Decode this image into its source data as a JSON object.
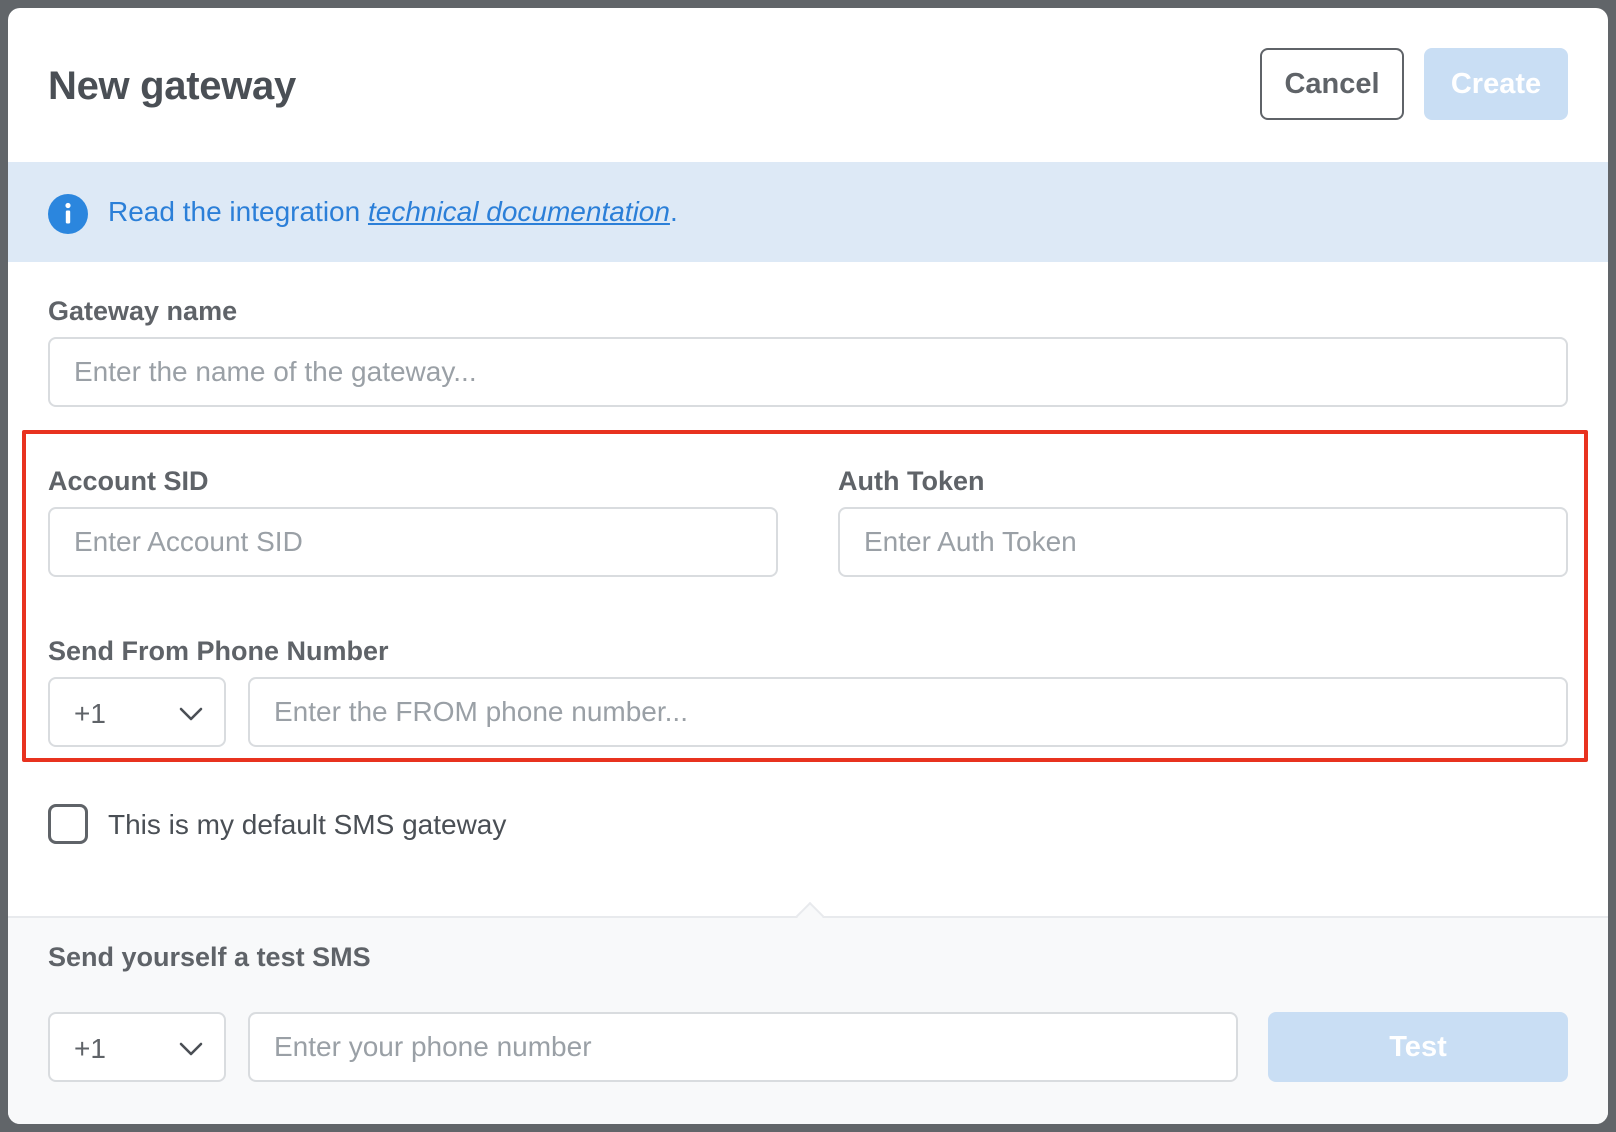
{
  "header": {
    "title": "New gateway",
    "cancel_label": "Cancel",
    "create_label": "Create"
  },
  "banner": {
    "text_before": "Read the integration ",
    "link_text": "technical documentation",
    "text_after": ".",
    "icon": "info-icon"
  },
  "form": {
    "gateway_name": {
      "label": "Gateway name",
      "placeholder": "Enter the name of the gateway...",
      "value": ""
    },
    "account_sid": {
      "label": "Account SID",
      "placeholder": "Enter Account SID",
      "value": ""
    },
    "auth_token": {
      "label": "Auth Token",
      "placeholder": "Enter Auth Token",
      "value": ""
    },
    "from_phone": {
      "label": "Send From Phone Number",
      "country_code": "+1",
      "placeholder": "Enter the FROM phone number...",
      "value": ""
    },
    "default_gateway": {
      "label": "This is my default SMS gateway",
      "checked": false
    }
  },
  "test_sms": {
    "label": "Send yourself a test SMS",
    "country_code": "+1",
    "placeholder": "Enter your phone number",
    "value": "",
    "test_label": "Test"
  },
  "colors": {
    "primary_disabled": "#c9def4",
    "link": "#2b7fd8",
    "banner_bg": "#dde9f6",
    "highlight": "#e8321f"
  }
}
